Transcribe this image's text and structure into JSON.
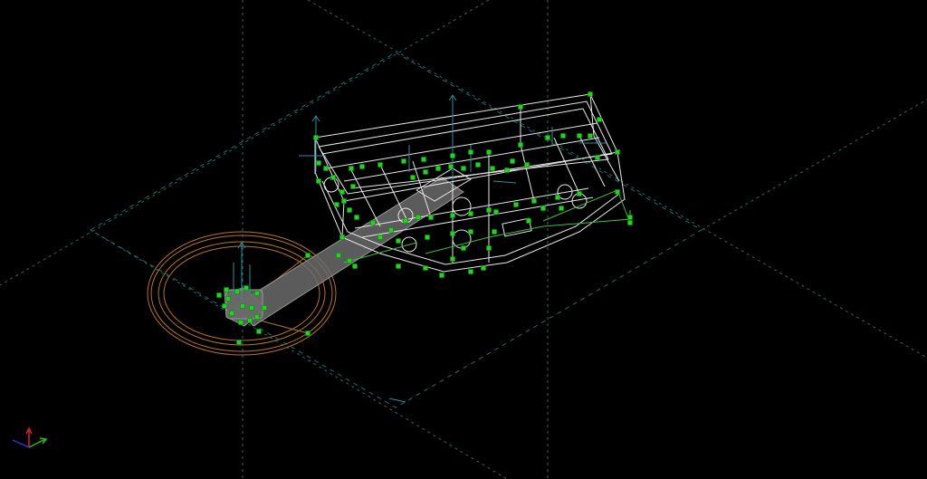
{
  "viewport": {
    "name": "3d-wireframe-viewport",
    "colors": {
      "background": "#000000",
      "grid": "#1f6f6a",
      "wireframe": "#e8e8e8",
      "selection_handles": "#1fd61f",
      "ring": "#b8751e",
      "axis_x": "#2db52d",
      "axis_y": "#d42222",
      "axis_z": "#2a3ad8"
    }
  },
  "axis_indicator": {
    "icons": [
      "axis-x-icon",
      "axis-y-icon",
      "axis-z-icon"
    ]
  }
}
